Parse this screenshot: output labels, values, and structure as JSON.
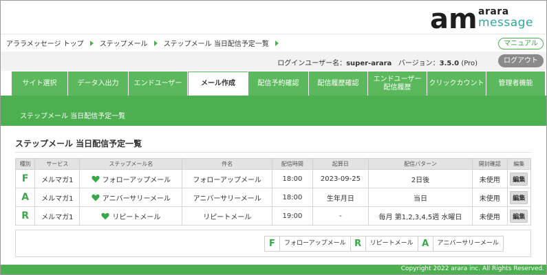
{
  "logo": {
    "mark": "am",
    "word1": "arara",
    "word2": "message"
  },
  "breadcrumb": [
    "アララメッセージ トップ",
    "ステップメール",
    "ステップメール 当日配信予定一覧"
  ],
  "manual_label": "マニュアル",
  "user": {
    "login_label": "ログインユーザー名：",
    "login_name": "super-arara",
    "version_label": "バージョン：",
    "version": "3.5.0",
    "edition": "(Pro)"
  },
  "logout_label": "ログアウト",
  "nav": [
    "サイト選択",
    "データ入出力",
    "エンドユーザー",
    "メール作成",
    "配信予約確認",
    "配信履歴確認",
    "エンドユーザー\n配信履歴",
    "クリックカウント",
    "管理者機能"
  ],
  "nav_active_index": 3,
  "title_bar": "ステップメール 当日配信予定一覧",
  "page_heading": "ステップメール 当日配信予定一覧",
  "table": {
    "headers": [
      "種別",
      "サービス",
      "ステップメール名",
      "件名",
      "配信時間",
      "起算日",
      "配信パターン",
      "開封確認",
      "編集"
    ],
    "rows": [
      {
        "type": "F",
        "service": "メルマガ1",
        "name": "フォローアップメール",
        "subject": "フォローアップメール",
        "time": "18:00",
        "start": "2023-09-25",
        "pattern": "2日後",
        "open": "未使用",
        "edit": "編集"
      },
      {
        "type": "A",
        "service": "メルマガ1",
        "name": "アニバーサリーメール",
        "subject": "アニバーサリーメール",
        "time": "18:00",
        "start": "生年月日",
        "pattern": "当日",
        "open": "未使用",
        "edit": "編集"
      },
      {
        "type": "R",
        "service": "メルマガ1",
        "name": "リピートメール",
        "subject": "リピートメール",
        "time": "19:00",
        "start": "-",
        "pattern": "毎月 第1,2,3,4,5週 水曜日",
        "open": "未使用",
        "edit": "編集"
      }
    ]
  },
  "legend": [
    {
      "letter": "F",
      "label": "フォローアップメール"
    },
    {
      "letter": "R",
      "label": "リピートメール"
    },
    {
      "letter": "A",
      "label": "アニバーサリーメール"
    }
  ],
  "footer": "Copyright 2022 arara inc. All Rights Reserved.",
  "colors": {
    "brand_green": "#4caf50",
    "type_green": "#3aa84a",
    "logo_teal": "#2fa8a0"
  }
}
